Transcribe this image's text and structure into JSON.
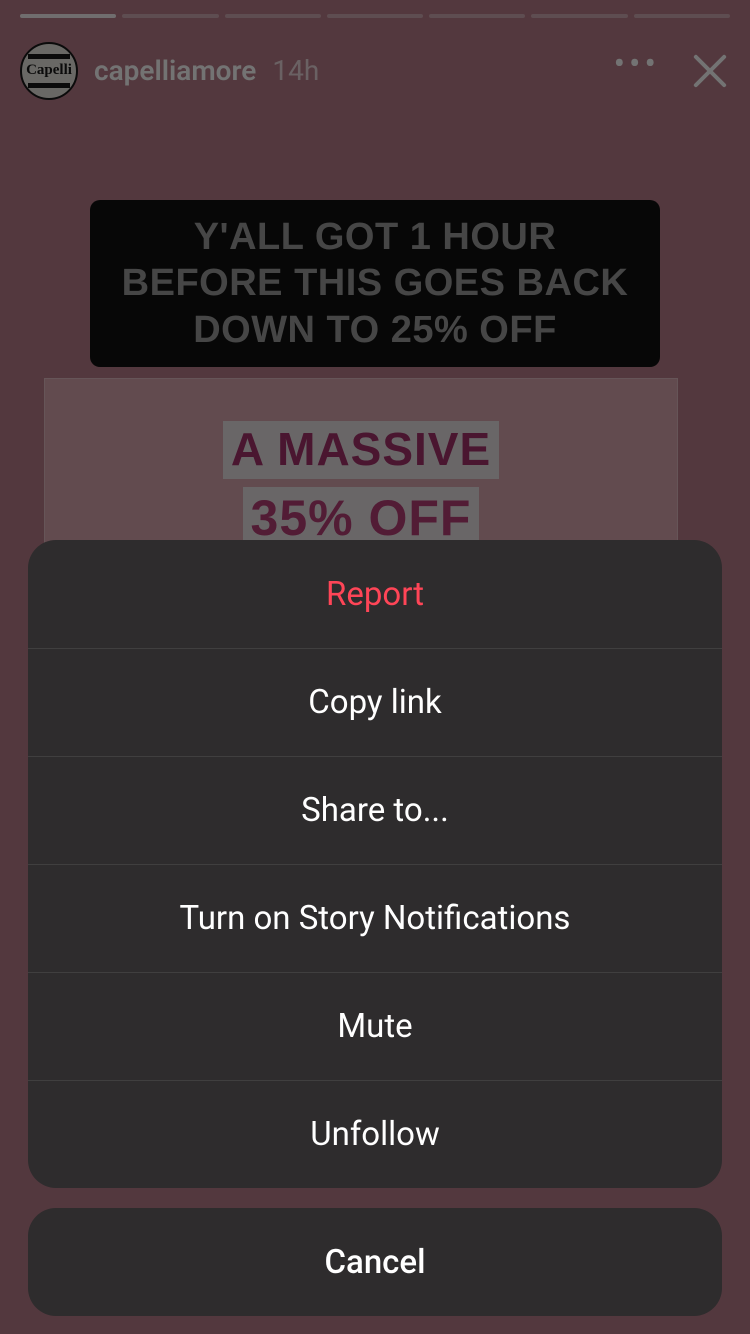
{
  "story": {
    "username": "capelliamore",
    "timestamp": "14h",
    "avatarText": "Capelli",
    "bannerText": "Y'ALL GOT 1 HOUR BEFORE THIS GOES BACK DOWN TO 25% OFF",
    "promoLine1": "A MASSIVE",
    "promoLine2": "35% OFF"
  },
  "sheet": {
    "items": [
      {
        "label": "Report",
        "danger": true,
        "name": "report-option"
      },
      {
        "label": "Copy link",
        "danger": false,
        "name": "copy-link-option"
      },
      {
        "label": "Share to...",
        "danger": false,
        "name": "share-to-option"
      },
      {
        "label": "Turn on Story Notifications",
        "danger": false,
        "name": "story-notifications-option"
      },
      {
        "label": "Mute",
        "danger": false,
        "name": "mute-option"
      },
      {
        "label": "Unfollow",
        "danger": false,
        "name": "unfollow-option"
      }
    ],
    "cancel": "Cancel"
  },
  "progressSegments": 7
}
